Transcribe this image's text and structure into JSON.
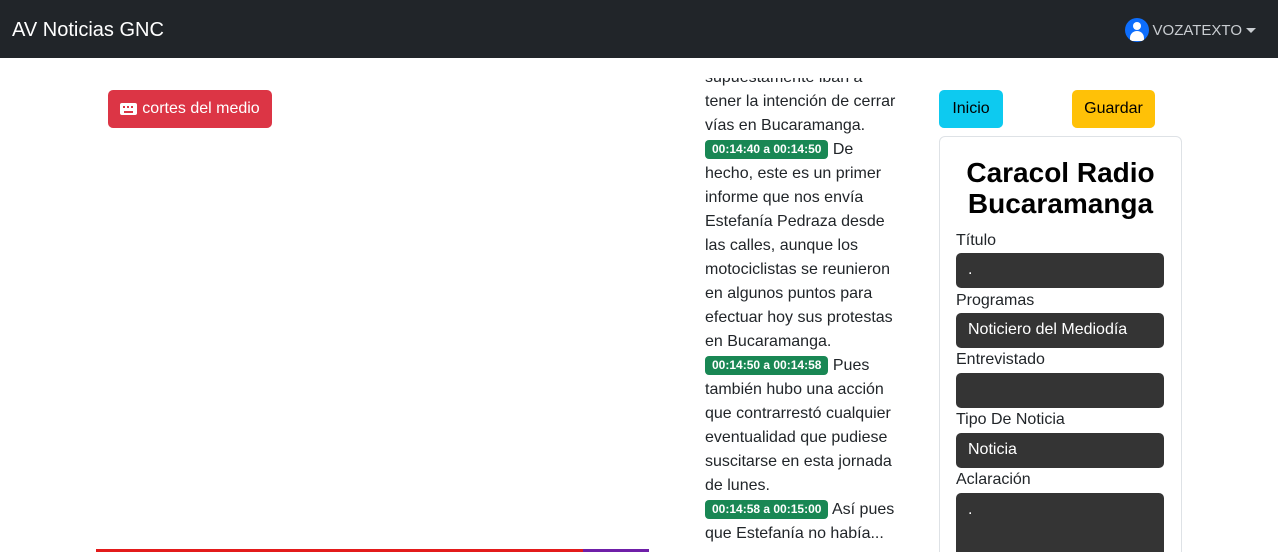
{
  "navbar": {
    "brand": "AV Noticias GNC",
    "user": "VOZATEXTO"
  },
  "buttons": {
    "cortes": "cortes del medio",
    "inicio": "Inicio",
    "guardar": "Guardar"
  },
  "transcript": {
    "lead": "supuestamente iban a tener la intención de cerrar vías en Bucaramanga.",
    "segments": [
      {
        "time": "00:14:40 a 00:14:50",
        "text": "De hecho, este es un primer informe que nos envía Estefanía Pedraza desde las calles, aunque los motociclistas se reunieron en algunos puntos para efectuar hoy sus protestas en Bucaramanga."
      },
      {
        "time": "00:14:50 a 00:14:58",
        "text": "Pues también hubo una acción que contrarrestó cualquier eventualidad que pudiese suscitarse en esta jornada de lunes."
      },
      {
        "time": "00:14:58 a 00:15:00",
        "text": "Así pues que Estefanía no había..."
      }
    ]
  },
  "form": {
    "title": "Caracol Radio Bucaramanga",
    "fields": [
      {
        "label": "Título",
        "value": "."
      },
      {
        "label": "Programas",
        "value": "Noticiero del Mediodía"
      },
      {
        "label": "Entrevistado",
        "value": ""
      },
      {
        "label": "Tipo De Noticia",
        "value": "Noticia"
      },
      {
        "label": "Aclaración",
        "value": "."
      }
    ]
  },
  "colors": {
    "navbar": "#212529",
    "danger": "#dc3545",
    "info": "#0dcaf0",
    "warning": "#ffc107",
    "success": "#198754",
    "field_bg": "#343434"
  },
  "icons": {
    "user": "user-avatar-icon",
    "cortes": "keyboard-icon",
    "dropdown": "caret-down-icon"
  }
}
